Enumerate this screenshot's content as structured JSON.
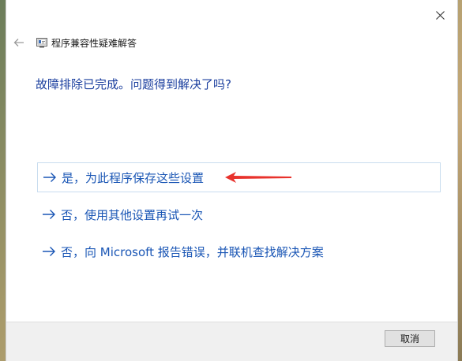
{
  "window": {
    "title": "程序兼容性疑难解答"
  },
  "icons": {
    "close": "close-icon",
    "back": "back-arrow-icon",
    "app": "compatibility-troubleshooter-icon",
    "option_arrow": "arrow-right-icon",
    "annotation": "red-pointer-arrow"
  },
  "main": {
    "question": "故障排除已完成。问题得到解决了吗?",
    "options": [
      {
        "label": "是，为此程序保存这些设置"
      },
      {
        "label": "否，使用其他设置再试一次"
      },
      {
        "label": "否，向 Microsoft 报告错误，并联机查找解决方案"
      }
    ]
  },
  "footer": {
    "cancel_label": "取消"
  },
  "colors": {
    "accent": "#1a56b5",
    "question": "#1a3e9e",
    "annotation_red": "#e8322c",
    "footer_bg": "#f0f0f0"
  }
}
